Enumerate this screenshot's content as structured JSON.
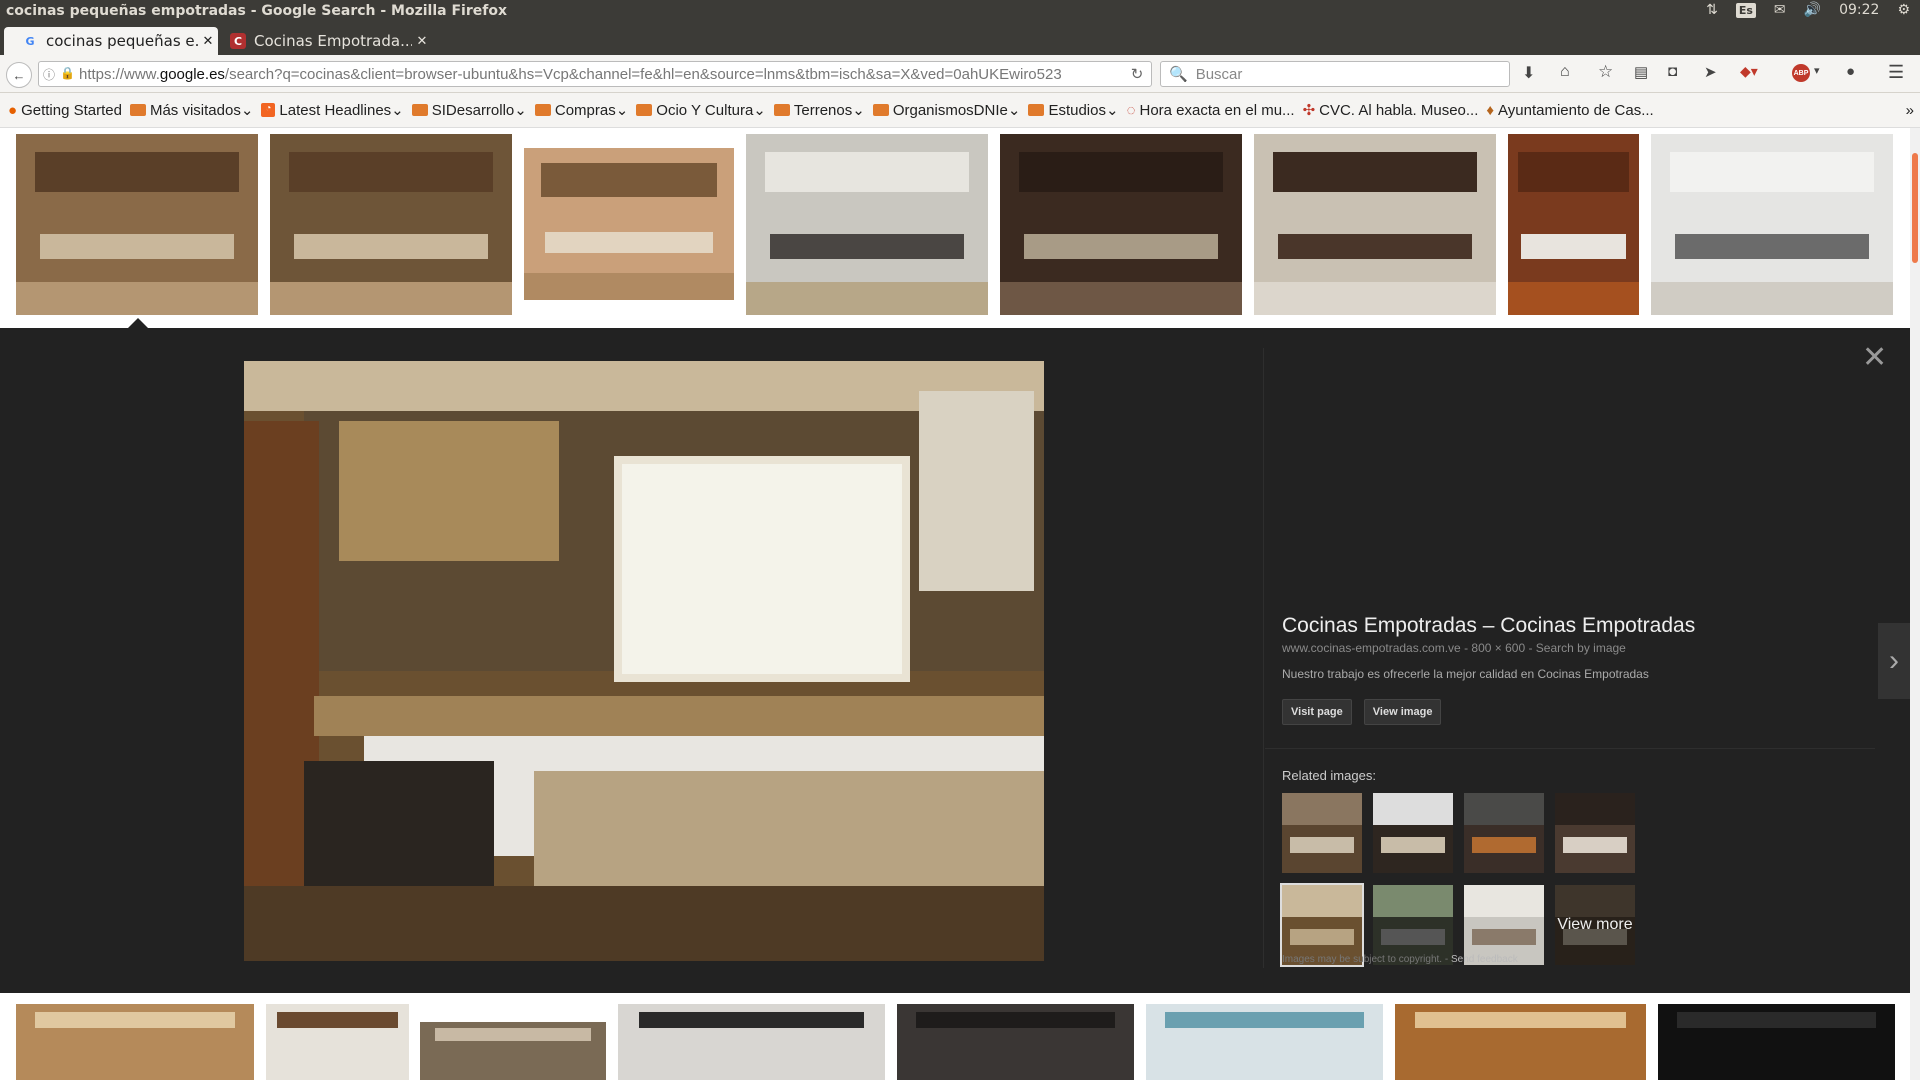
{
  "window_title": "cocinas pequeñas empotradas - Google Search - Mozilla Firefox",
  "tray": {
    "lang": "Es",
    "time": "09:22"
  },
  "tabs": [
    {
      "label": "cocinas pequeñas e...",
      "favicon": "G"
    },
    {
      "label": "Cocinas Empotrada...",
      "favicon": "C"
    }
  ],
  "url": {
    "prefix": "https://www.",
    "host": "google.es",
    "path": "/search?q=cocinas&client=browser-ubuntu&hs=Vcp&channel=fe&hl=en&source=lnms&tbm=isch&sa=X&ved=0ahUKEwiro523"
  },
  "search_placeholder": "Buscar",
  "bookmarks": [
    {
      "label": "Getting Started",
      "icon": "firefox-icon"
    },
    {
      "label": "Más visitados",
      "icon": "folder-icon",
      "dropdown": true
    },
    {
      "label": "Latest Headlines",
      "icon": "rss-icon",
      "dropdown": true
    },
    {
      "label": "SIDesarrollo",
      "icon": "folder-icon",
      "dropdown": true
    },
    {
      "label": "Compras",
      "icon": "folder-icon",
      "dropdown": true
    },
    {
      "label": "Ocio Y Cultura",
      "icon": "folder-icon",
      "dropdown": true
    },
    {
      "label": "Terrenos",
      "icon": "folder-icon",
      "dropdown": true
    },
    {
      "label": "OrganismosDNIe",
      "icon": "folder-icon",
      "dropdown": true
    },
    {
      "label": "Estudios",
      "icon": "folder-icon",
      "dropdown": true
    },
    {
      "label": "Hora exacta en el mu...",
      "icon": "clock-icon"
    },
    {
      "label": "CVC. Al habla. Museo...",
      "icon": "cvc-icon"
    },
    {
      "label": "Ayuntamiento de Cas...",
      "icon": "crest-icon"
    }
  ],
  "result": {
    "title": "Cocinas Empotradas – Cocinas Empotradas",
    "source": "www.cocinas-empotradas.com.ve",
    "dimensions": "800 × 600",
    "search_by_image": "Search by image",
    "description": "Nuestro trabajo es ofrecerle la mejor calidad en Cocinas Empotradas",
    "visit_page": "Visit page",
    "view_image": "View image",
    "related_label": "Related images:",
    "view_more": "View more",
    "copyright": "Images may be subject to copyright.",
    "feedback": "Send feedback"
  }
}
